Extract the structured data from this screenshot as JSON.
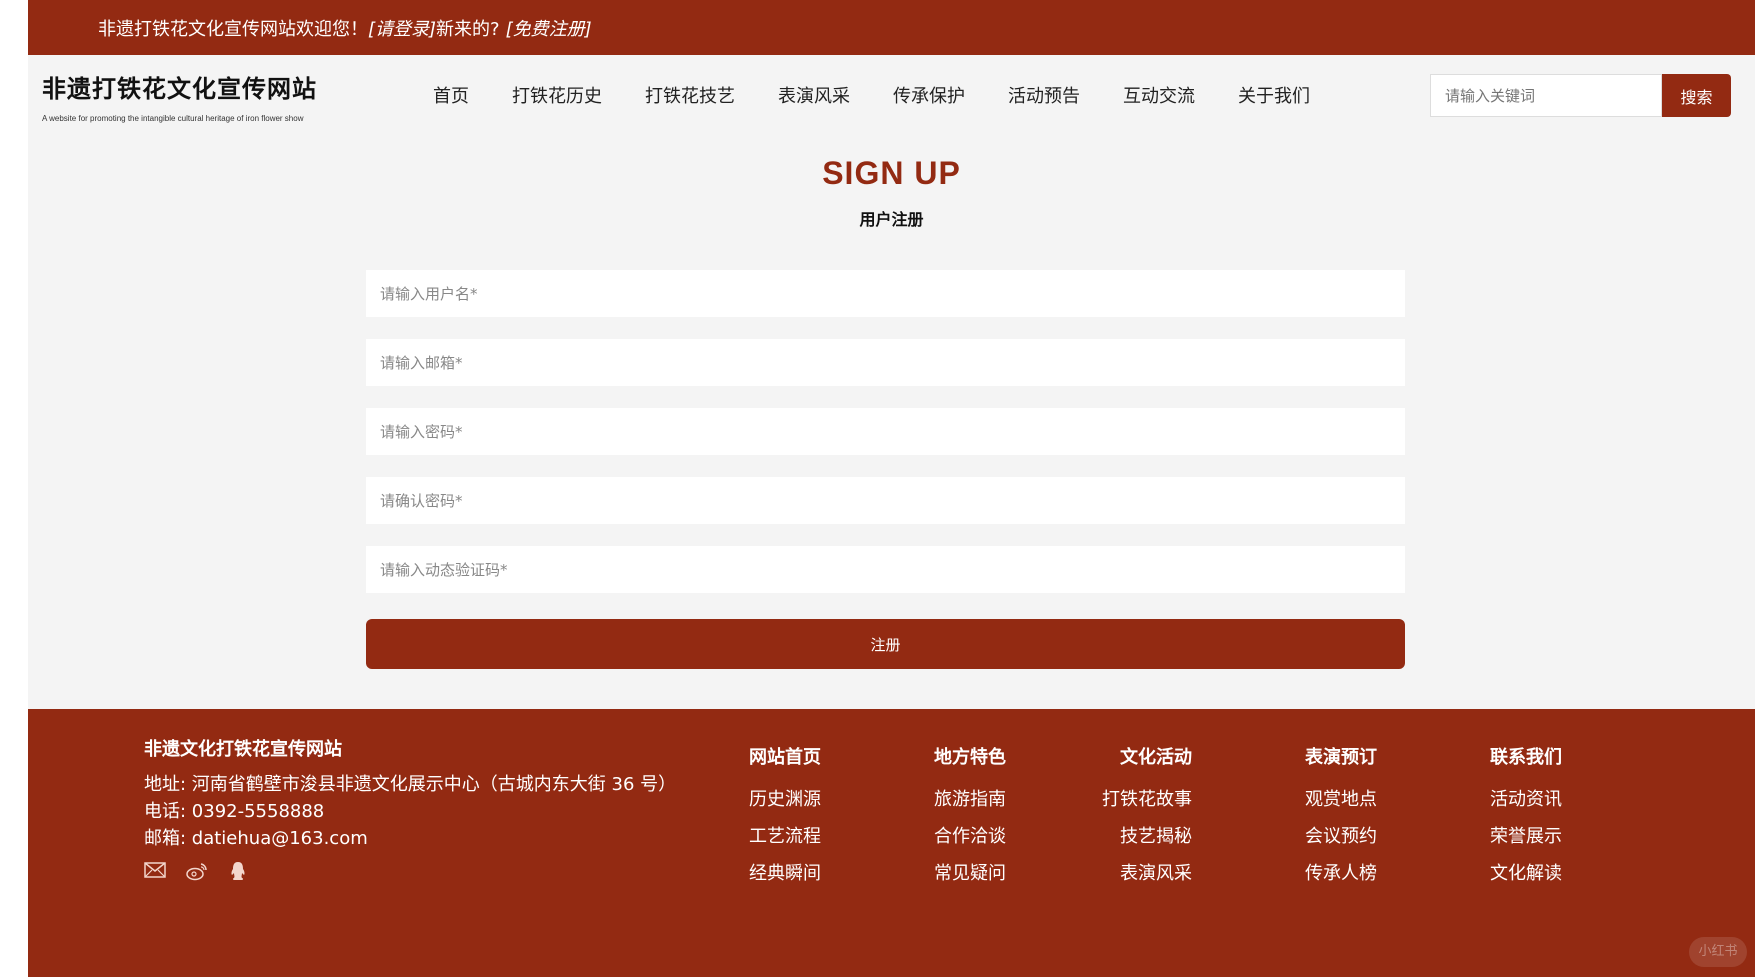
{
  "topbar": {
    "welcome": "非遗打铁花文化宣传网站欢迎您！",
    "login_link": "[请登录]",
    "new_text": "新来的?",
    "register_link": "[免费注册]"
  },
  "header": {
    "site_title": "非遗打铁花文化宣传网站",
    "site_subtitle": "A website for promoting the intangible cultural heritage of iron flower show",
    "nav": [
      "首页",
      "打铁花历史",
      "打铁花技艺",
      "表演风采",
      "传承保护",
      "活动预告",
      "互动交流",
      "关于我们"
    ],
    "search_placeholder": "请输入关键词",
    "search_button": "搜索"
  },
  "form": {
    "title": "SIGN UP",
    "subtitle": "用户注册",
    "username_placeholder": "请输入用户名*",
    "email_placeholder": "请输入邮箱*",
    "password_placeholder": "请输入密码*",
    "confirm_placeholder": "请确认密码*",
    "code_placeholder": "请输入动态验证码*",
    "submit": "注册"
  },
  "footer": {
    "site_name": "非遗文化打铁花宣传网站",
    "address": "地址: 河南省鹤壁市浚县非遗文化展示中心（古城内东大街 36 号）",
    "phone": "电话: 0392-5558888",
    "email": "邮箱: datiehua@163.com",
    "icons": [
      "mail-icon",
      "weibo-icon",
      "qq-icon"
    ],
    "columns": [
      {
        "head": "网站首页",
        "items": [
          "历史渊源",
          "工艺流程",
          "经典瞬间"
        ]
      },
      {
        "head": "地方特色",
        "items": [
          "旅游指南",
          "合作洽谈",
          "常见疑问"
        ]
      },
      {
        "head": "文化活动",
        "items": [
          "打铁花故事",
          "技艺揭秘",
          "表演风采"
        ]
      },
      {
        "head": "表演预订",
        "items": [
          "观赏地点",
          "会议预约",
          "传承人榜"
        ]
      },
      {
        "head": "联系我们",
        "items": [
          "活动资讯",
          "荣誉展示",
          "文化解读"
        ]
      }
    ],
    "watermark": "小红书"
  },
  "colors": {
    "brand": "#932a12",
    "background": "#f4f4f4"
  }
}
